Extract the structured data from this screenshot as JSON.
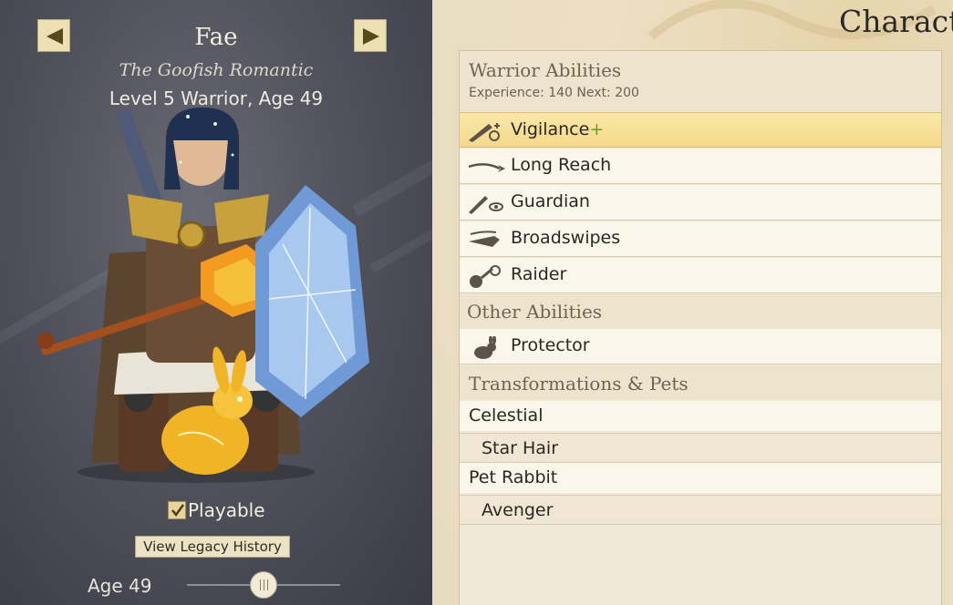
{
  "character": {
    "name": "Fae",
    "title": "The Goofish Romantic",
    "level_line": "Level 5 Warrior, Age 49",
    "playable_label": "Playable",
    "playable_checked": true,
    "legacy_button": "View Legacy History",
    "age_label": "Age 49"
  },
  "page": {
    "heading": "Characte"
  },
  "abilities": {
    "section_title": "Warrior Abilities",
    "experience_line": "Experience: 140   Next: 200",
    "items": [
      {
        "label": "Vigilance",
        "suffix": "+",
        "icon": "sword-eye-icon",
        "selected": true
      },
      {
        "label": "Long Reach",
        "icon": "reach-streak-icon"
      },
      {
        "label": "Guardian",
        "icon": "dagger-eye-icon"
      },
      {
        "label": "Broadswipes",
        "icon": "swipe-blade-icon"
      },
      {
        "label": "Raider",
        "icon": "flail-icon"
      }
    ]
  },
  "other_abilities": {
    "section_title": "Other Abilities",
    "items": [
      {
        "label": "Protector",
        "icon": "rabbit-icon"
      }
    ]
  },
  "transformations": {
    "section_title": "Transformations & Pets",
    "items": [
      {
        "label": "Celestial",
        "level": "main"
      },
      {
        "label": "Star Hair",
        "level": "sub"
      },
      {
        "label": "Pet Rabbit",
        "level": "main"
      },
      {
        "label": "Avenger",
        "level": "sub"
      }
    ]
  },
  "colors": {
    "left_bg": "#51525c",
    "parchment": "#f1e9d8",
    "selected_row": "#f6df95",
    "accent_gold": "#e7d49a"
  }
}
